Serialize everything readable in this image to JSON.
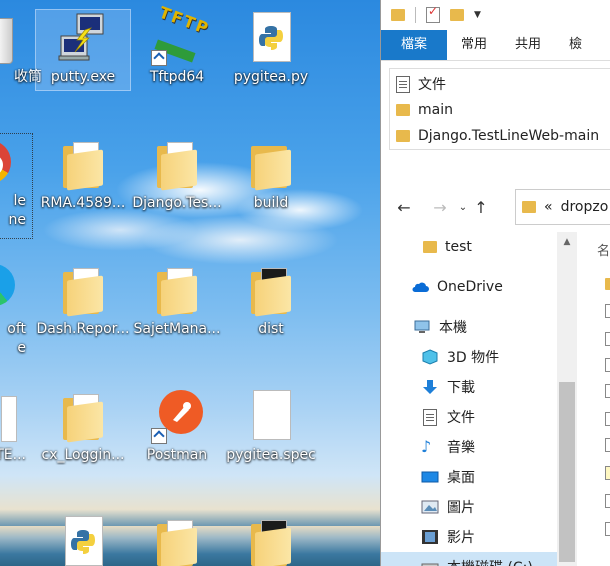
{
  "desktop": {
    "icons": [
      {
        "label": "收筒"
      },
      {
        "label": "putty.exe"
      },
      {
        "label": "Tftpd64"
      },
      {
        "label": "pygitea.py"
      },
      {
        "label": "le"
      },
      {
        "label": "ne"
      },
      {
        "label": "RMA.4589..."
      },
      {
        "label": "Django.Tes..."
      },
      {
        "label": "build"
      },
      {
        "label": "oft"
      },
      {
        "label": "e"
      },
      {
        "label": "Dash.Repor..."
      },
      {
        "label": "SajetMana..."
      },
      {
        "label": "dist"
      },
      {
        "label": "YTE..."
      },
      {
        "label": "cx_Loggin..."
      },
      {
        "label": "Postman"
      },
      {
        "label": "pygitea.spec"
      }
    ],
    "tftp_letters": "TFTP"
  },
  "explorer": {
    "ribbon_tabs": [
      "檔案",
      "常用",
      "共用",
      "檢"
    ],
    "pinned": [
      {
        "label": "文件"
      },
      {
        "label": "main"
      },
      {
        "label": "Django.TestLineWeb-main"
      }
    ],
    "address": {
      "prefix": "«",
      "path": "dropzo"
    },
    "nav_items": [
      {
        "label": "test"
      },
      {
        "label": "OneDrive"
      },
      {
        "label": "本機"
      },
      {
        "label": "3D 物件"
      },
      {
        "label": "下載"
      },
      {
        "label": "文件"
      },
      {
        "label": "音樂"
      },
      {
        "label": "桌面"
      },
      {
        "label": "圖片"
      },
      {
        "label": "影片"
      },
      {
        "label": "本機磁碟 (C:)"
      }
    ],
    "column_header_fragment": "名"
  },
  "colors": {
    "file_tab": "#1979ca",
    "folder": "#e8b94c",
    "onedrive": "#0a6cd6"
  }
}
